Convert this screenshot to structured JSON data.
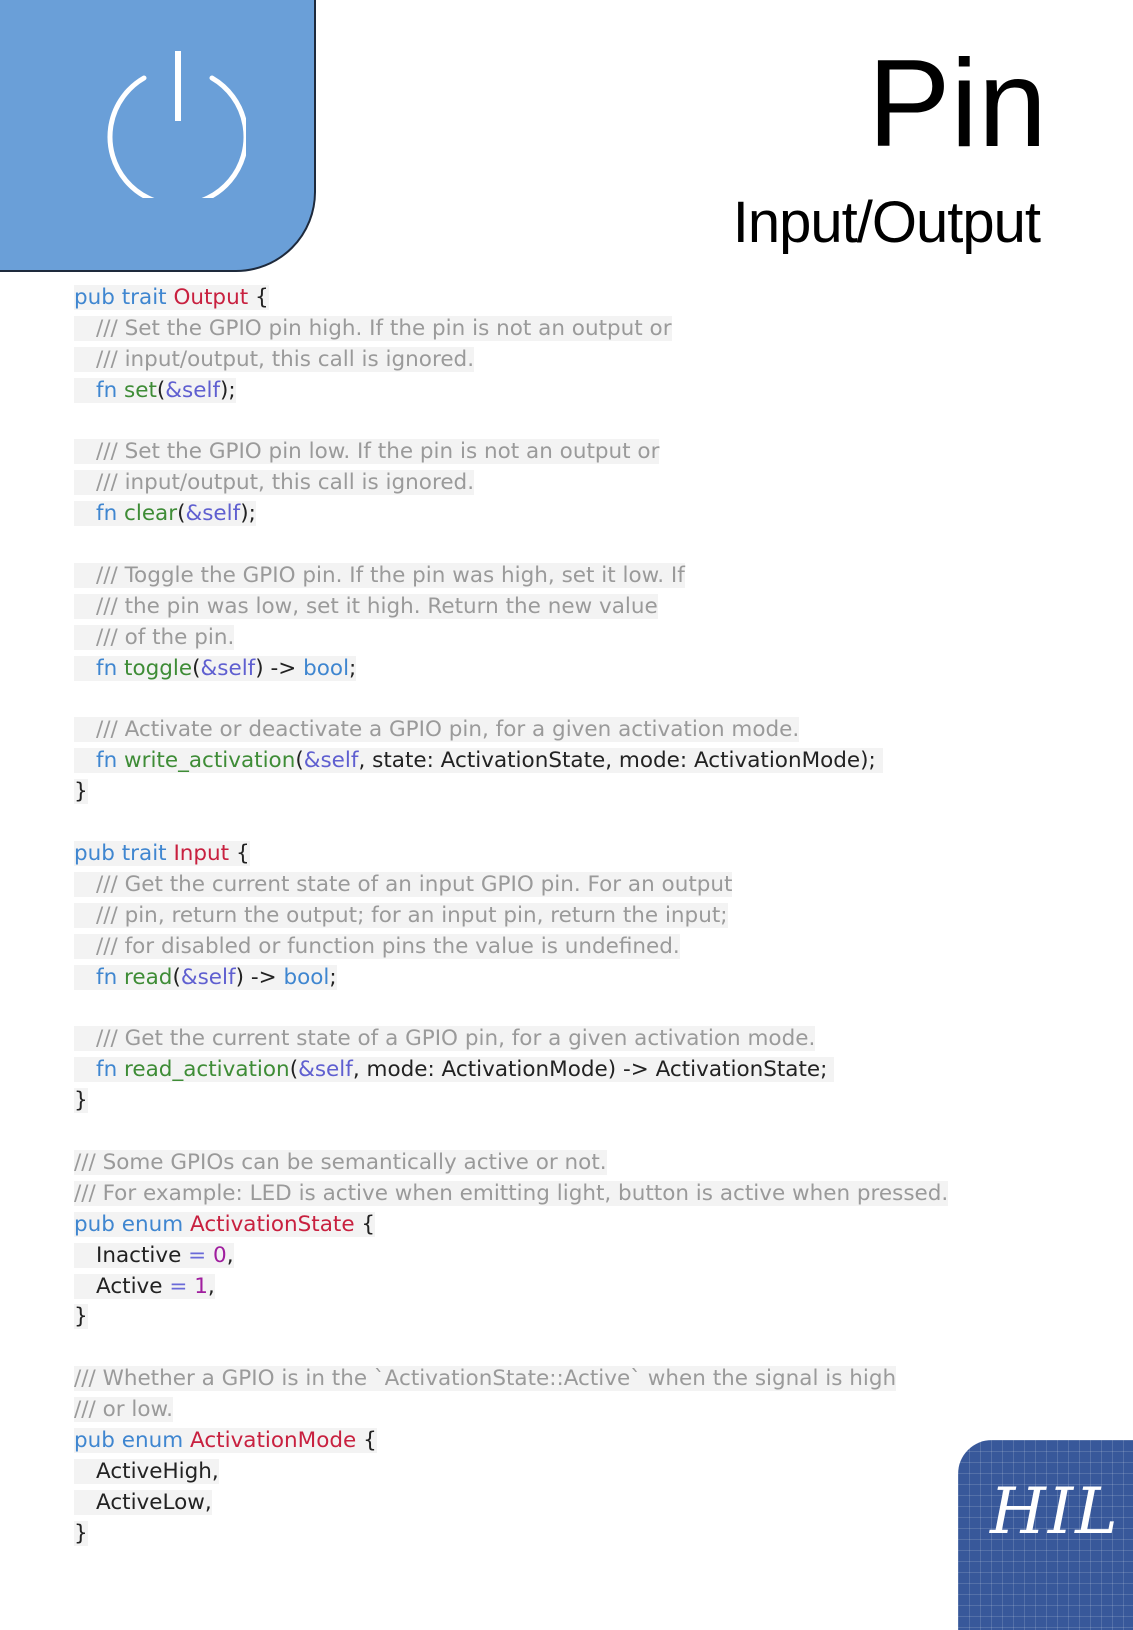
{
  "header": {
    "title": "Pin",
    "subtitle": "Input/Output",
    "icon": "power-icon",
    "badge_color": "#6a9fd8"
  },
  "footer_badge": {
    "label": "HIL",
    "color": "#38589a"
  },
  "code": {
    "language": "rust",
    "lines": [
      {
        "indent": false,
        "shade": true,
        "tokens": [
          {
            "t": "pub trait ",
            "c": "kw"
          },
          {
            "t": "Output",
            "c": "ty"
          },
          {
            "t": " {",
            "c": "pl"
          }
        ]
      },
      {
        "indent": true,
        "shade": true,
        "tokens": [
          {
            "t": "/// Set the GPIO pin high. If the pin is not an output or",
            "c": "cm"
          }
        ]
      },
      {
        "indent": true,
        "shade": true,
        "tokens": [
          {
            "t": "/// input/output, this call is ignored.",
            "c": "cm"
          }
        ]
      },
      {
        "indent": true,
        "shade": true,
        "tokens": [
          {
            "t": "fn ",
            "c": "kw"
          },
          {
            "t": "set",
            "c": "fn"
          },
          {
            "t": "(",
            "c": "pl"
          },
          {
            "t": "&self",
            "c": "sf"
          },
          {
            "t": ");",
            "c": "pl"
          }
        ]
      },
      {
        "blank": true
      },
      {
        "indent": true,
        "shade": true,
        "tokens": [
          {
            "t": "/// Set the GPIO pin low. If the pin is not an output or",
            "c": "cm"
          }
        ]
      },
      {
        "indent": true,
        "shade": true,
        "tokens": [
          {
            "t": "/// input/output, this call is ignored.",
            "c": "cm"
          }
        ]
      },
      {
        "indent": true,
        "shade": true,
        "tokens": [
          {
            "t": "fn ",
            "c": "kw"
          },
          {
            "t": "clear",
            "c": "fn"
          },
          {
            "t": "(",
            "c": "pl"
          },
          {
            "t": "&self",
            "c": "sf"
          },
          {
            "t": ");",
            "c": "pl"
          }
        ]
      },
      {
        "blank": true
      },
      {
        "indent": true,
        "shade": true,
        "tokens": [
          {
            "t": "/// Toggle the GPIO pin. If the pin was high, set it low. If",
            "c": "cm"
          }
        ]
      },
      {
        "indent": true,
        "shade": true,
        "tokens": [
          {
            "t": "/// the pin was low, set it high. Return the new value",
            "c": "cm"
          }
        ]
      },
      {
        "indent": true,
        "shade": true,
        "tokens": [
          {
            "t": "/// of the pin.",
            "c": "cm"
          }
        ]
      },
      {
        "indent": true,
        "shade": true,
        "tokens": [
          {
            "t": "fn ",
            "c": "kw"
          },
          {
            "t": "toggle",
            "c": "fn"
          },
          {
            "t": "(",
            "c": "pl"
          },
          {
            "t": "&self",
            "c": "sf"
          },
          {
            "t": ") -> ",
            "c": "pl"
          },
          {
            "t": "bool",
            "c": "kw"
          },
          {
            "t": ";",
            "c": "pl"
          }
        ]
      },
      {
        "blank": true
      },
      {
        "indent": true,
        "shade": true,
        "tokens": [
          {
            "t": "/// Activate or deactivate a GPIO pin, for a given activation mode.",
            "c": "cm"
          }
        ]
      },
      {
        "indent": true,
        "shade": true,
        "tokens": [
          {
            "t": "fn ",
            "c": "kw"
          },
          {
            "t": "write_activation",
            "c": "fn"
          },
          {
            "t": "(",
            "c": "pl"
          },
          {
            "t": "&self",
            "c": "sf"
          },
          {
            "t": ", state: ActivationState, mode: ActivationMode); ",
            "c": "pl"
          }
        ]
      },
      {
        "indent": false,
        "shade": true,
        "tokens": [
          {
            "t": "}",
            "c": "pl"
          }
        ]
      },
      {
        "blank": true
      },
      {
        "indent": false,
        "shade": true,
        "tokens": [
          {
            "t": "pub trait ",
            "c": "kw"
          },
          {
            "t": "Input",
            "c": "ty"
          },
          {
            "t": " {",
            "c": "pl"
          }
        ]
      },
      {
        "indent": true,
        "shade": true,
        "tokens": [
          {
            "t": "/// Get the current state of an input GPIO pin. For an output",
            "c": "cm"
          }
        ]
      },
      {
        "indent": true,
        "shade": true,
        "tokens": [
          {
            "t": "/// pin, return the output; for an input pin, return the input;",
            "c": "cm"
          }
        ]
      },
      {
        "indent": true,
        "shade": true,
        "tokens": [
          {
            "t": "/// for disabled or function pins the value is undefined.",
            "c": "cm"
          }
        ]
      },
      {
        "indent": true,
        "shade": true,
        "tokens": [
          {
            "t": "fn ",
            "c": "kw"
          },
          {
            "t": "read",
            "c": "fn"
          },
          {
            "t": "(",
            "c": "pl"
          },
          {
            "t": "&self",
            "c": "sf"
          },
          {
            "t": ") -> ",
            "c": "pl"
          },
          {
            "t": "bool",
            "c": "kw"
          },
          {
            "t": ";",
            "c": "pl"
          }
        ]
      },
      {
        "blank": true
      },
      {
        "indent": true,
        "shade": true,
        "tokens": [
          {
            "t": "/// Get the current state of a GPIO pin, for a given activation mode.",
            "c": "cm"
          }
        ]
      },
      {
        "indent": true,
        "shade": true,
        "tokens": [
          {
            "t": "fn ",
            "c": "kw"
          },
          {
            "t": "read_activation",
            "c": "fn"
          },
          {
            "t": "(",
            "c": "pl"
          },
          {
            "t": "&self",
            "c": "sf"
          },
          {
            "t": ", mode: ActivationMode) -> ActivationState; ",
            "c": "pl"
          }
        ]
      },
      {
        "indent": false,
        "shade": true,
        "tokens": [
          {
            "t": "}",
            "c": "pl"
          }
        ]
      },
      {
        "blank": true
      },
      {
        "indent": false,
        "shade": true,
        "tokens": [
          {
            "t": "/// Some GPIOs can be semantically active or not.",
            "c": "cm"
          }
        ]
      },
      {
        "indent": false,
        "shade": true,
        "tokens": [
          {
            "t": "/// For example: LED is active when emitting light, button is active when pressed.",
            "c": "cm"
          }
        ]
      },
      {
        "indent": false,
        "shade": true,
        "tokens": [
          {
            "t": "pub enum ",
            "c": "kw"
          },
          {
            "t": "ActivationState",
            "c": "ty"
          },
          {
            "t": " {",
            "c": "pl"
          }
        ]
      },
      {
        "indent": true,
        "shade": true,
        "tokens": [
          {
            "t": "Inactive ",
            "c": "pl"
          },
          {
            "t": "=",
            "c": "eq"
          },
          {
            "t": " ",
            "c": "pl"
          },
          {
            "t": "0",
            "c": "nm"
          },
          {
            "t": ",",
            "c": "pl"
          }
        ]
      },
      {
        "indent": true,
        "shade": true,
        "tokens": [
          {
            "t": "Active ",
            "c": "pl"
          },
          {
            "t": "=",
            "c": "eq"
          },
          {
            "t": " ",
            "c": "pl"
          },
          {
            "t": "1",
            "c": "nm"
          },
          {
            "t": ",",
            "c": "pl"
          }
        ]
      },
      {
        "indent": false,
        "shade": true,
        "tokens": [
          {
            "t": "}",
            "c": "pl"
          }
        ]
      },
      {
        "blank": true
      },
      {
        "indent": false,
        "shade": true,
        "tokens": [
          {
            "t": "/// Whether a GPIO is in the `ActivationState::Active` when the signal is high",
            "c": "cm"
          }
        ]
      },
      {
        "indent": false,
        "shade": true,
        "tokens": [
          {
            "t": "/// or low.",
            "c": "cm"
          }
        ]
      },
      {
        "indent": false,
        "shade": true,
        "tokens": [
          {
            "t": "pub enum ",
            "c": "kw"
          },
          {
            "t": "ActivationMode",
            "c": "ty"
          },
          {
            "t": " {",
            "c": "pl"
          }
        ]
      },
      {
        "indent": true,
        "shade": true,
        "tokens": [
          {
            "t": "ActiveHigh,",
            "c": "pl"
          }
        ]
      },
      {
        "indent": true,
        "shade": true,
        "tokens": [
          {
            "t": "ActiveLow,",
            "c": "pl"
          }
        ]
      },
      {
        "indent": false,
        "shade": true,
        "tokens": [
          {
            "t": "}",
            "c": "pl"
          }
        ]
      }
    ]
  }
}
